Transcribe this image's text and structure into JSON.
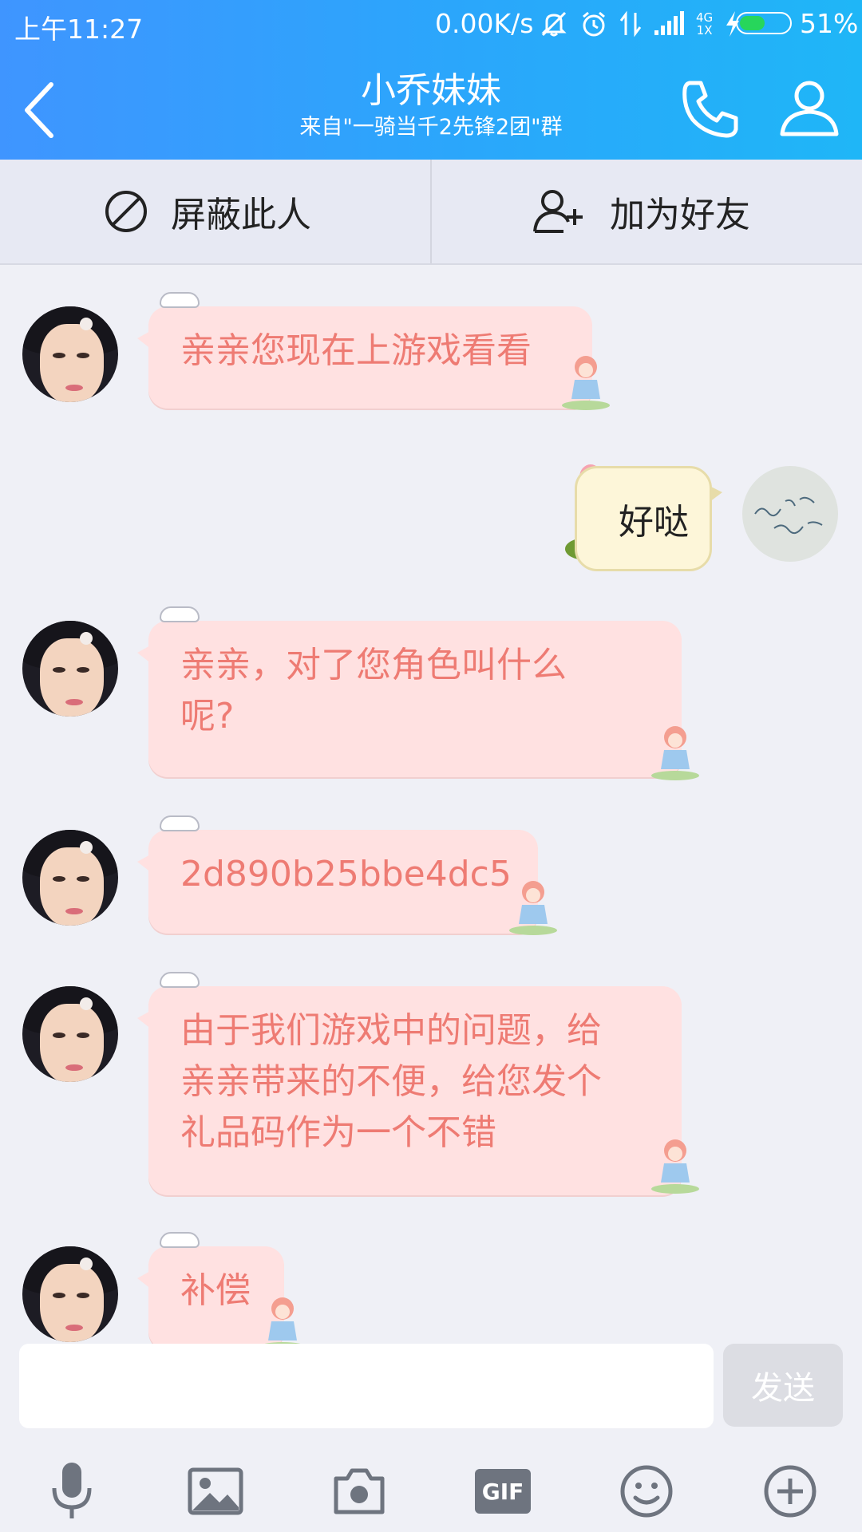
{
  "status_bar": {
    "time": "上午11:27",
    "network_speed": "0.00K/s",
    "icons": [
      "mute-icon",
      "alarm-icon",
      "data-transfer-icon",
      "signal-icon",
      "4g-1x-icon",
      "charging-icon",
      "battery-icon"
    ],
    "network_type_top": "4G",
    "network_type_bottom": "1X",
    "battery_level": 0.51,
    "battery_text": "51%"
  },
  "header": {
    "title": "小乔妹妹",
    "subtitle": "来自\"一骑当千2先锋2团\"群",
    "back_icon": "chevron-left-icon",
    "call_icon": "phone-icon",
    "profile_icon": "person-icon"
  },
  "actions": {
    "block": {
      "label": "屏蔽此人",
      "icon": "block-icon"
    },
    "add_friend": {
      "label": "加为好友",
      "icon": "add-person-icon"
    }
  },
  "messages": [
    {
      "from": "other",
      "text": "亲亲您现在上游戏看看"
    },
    {
      "from": "self",
      "text": "好哒"
    },
    {
      "from": "other",
      "text": "亲亲，对了您角色叫什么呢?"
    },
    {
      "from": "other",
      "text": "2d890b25bbe4dc5"
    },
    {
      "from": "other",
      "text": "由于我们游戏中的问题，给亲亲带来的不便，给您发个礼品码作为一个不错"
    },
    {
      "from": "other",
      "text": "补偿"
    }
  ],
  "composer": {
    "input_value": "",
    "send_label": "发送",
    "tools": [
      "microphone-icon",
      "image-icon",
      "camera-icon",
      "gif-icon",
      "emoji-icon",
      "plus-icon"
    ],
    "gif_label": "GIF"
  },
  "colors": {
    "header_gradient_start": "#3f95ff",
    "header_gradient_end": "#1fb6f7",
    "bubble_background": "#ffe1e1",
    "bubble_text": "#ee7b73",
    "self_bubble_background": "#fdf6d9",
    "battery_fill": "#27d65b"
  }
}
